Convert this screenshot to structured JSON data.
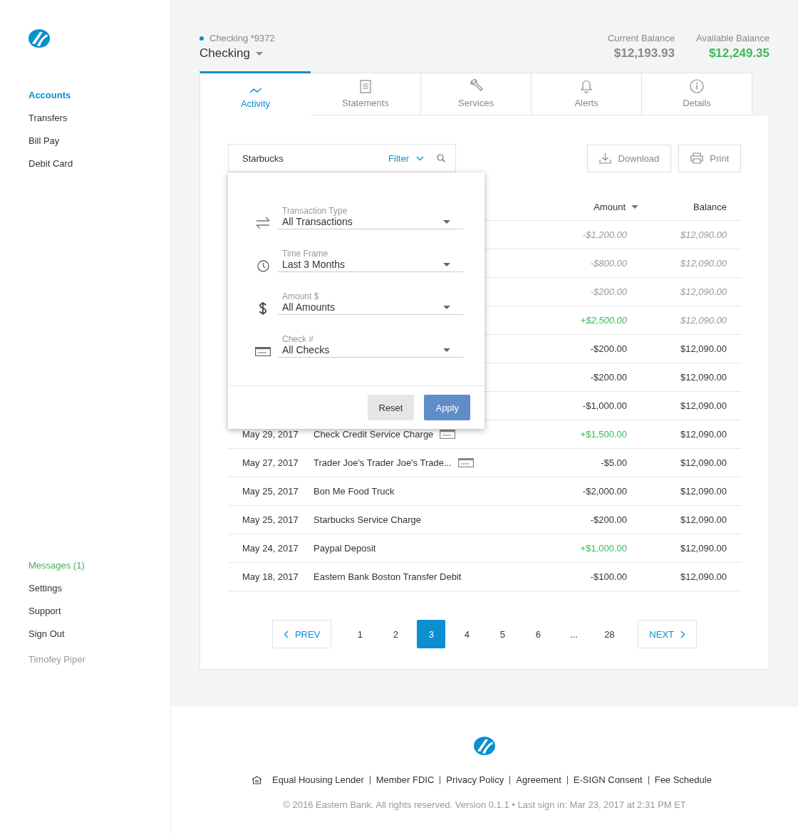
{
  "sidebar": {
    "nav": [
      {
        "label": "Accounts",
        "selected": true
      },
      {
        "label": "Transfers",
        "selected": false
      },
      {
        "label": "Bill Pay",
        "selected": false
      },
      {
        "label": "Debit Card",
        "selected": false
      }
    ],
    "bottom": [
      {
        "label": "Messages (1)",
        "kind": "messages"
      },
      {
        "label": "Settings",
        "kind": "link"
      },
      {
        "label": "Support",
        "kind": "link"
      },
      {
        "label": "Sign Out",
        "kind": "link"
      }
    ],
    "user": "Timofey Piper"
  },
  "account": {
    "subtitle": "Checking *9372",
    "name": "Checking",
    "balances": [
      {
        "label": "Current Balance",
        "value": "$12,193.93",
        "kind": "current"
      },
      {
        "label": "Available Balance",
        "value": "$12,249.35",
        "kind": "available"
      }
    ]
  },
  "tabs": [
    {
      "label": "Activity",
      "kind": "activity",
      "selected": true
    },
    {
      "label": "Statements",
      "kind": "statements",
      "selected": false
    },
    {
      "label": "Services",
      "kind": "services",
      "selected": false
    },
    {
      "label": "Alerts",
      "kind": "alerts",
      "selected": false
    },
    {
      "label": "Details",
      "kind": "details",
      "selected": false
    }
  ],
  "search": {
    "value": "Starbucks",
    "filter_label": "Filter"
  },
  "actions": [
    {
      "label": "Download",
      "kind": "download"
    },
    {
      "label": "Print",
      "kind": "print"
    }
  ],
  "table": {
    "columns": [
      {
        "label": "Amount",
        "sorted": true
      },
      {
        "label": "Balance",
        "sorted": false
      }
    ],
    "rows": [
      {
        "amount": "-$1,200.00",
        "balance": "$12,090.00",
        "pending": true,
        "credit": false
      },
      {
        "amount": "-$800.00",
        "balance": "$12,090.00",
        "pending": true,
        "credit": false
      },
      {
        "amount": "-$200.00",
        "balance": "$12,090.00",
        "pending": true,
        "credit": false
      },
      {
        "amount": "+$2,500.00",
        "balance": "$12,090.00",
        "pending": true,
        "credit": true
      },
      {
        "amount": "-$200.00",
        "balance": "$12,090.00",
        "pending": false,
        "credit": false
      },
      {
        "amount": "-$200.00",
        "balance": "$12,090.00",
        "pending": false,
        "credit": false
      },
      {
        "amount": "-$1,000.00",
        "balance": "$12,090.00",
        "pending": false,
        "credit": false
      },
      {
        "date": "May 29, 2017",
        "description": "Check Credit Service Charge",
        "amount": "+$1,500.00",
        "balance": "$12,090.00",
        "pending": false,
        "credit": true,
        "check": true
      },
      {
        "date": "May 27, 2017",
        "description": "Trader Joe's Trader Joe's Trade...",
        "amount": "-$5.00",
        "balance": "$12,090.00",
        "pending": false,
        "credit": false,
        "check": true
      },
      {
        "date": "May 25, 2017",
        "description": "Bon Me Food Truck",
        "amount": "-$2,000.00",
        "balance": "$12,090.00",
        "pending": false,
        "credit": false,
        "check": false
      },
      {
        "date": "May 25, 2017",
        "description": "Starbucks Service Charge",
        "amount": "-$200.00",
        "balance": "$12,090.00",
        "pending": false,
        "credit": false,
        "check": false
      },
      {
        "date": "May 24, 2017",
        "description": "Paypal Deposit",
        "amount": "+$1,000.00",
        "balance": "$12,090.00",
        "pending": false,
        "credit": true,
        "check": false
      },
      {
        "date": "May 18, 2017",
        "description": "Eastern Bank Boston Transfer Debit",
        "amount": "-$100.00",
        "balance": "$12,090.00",
        "pending": false,
        "credit": false,
        "check": false
      }
    ]
  },
  "filter_panel": {
    "fields": [
      {
        "kind": "type",
        "label": "Transaction Type",
        "value": "All Transactions"
      },
      {
        "kind": "time",
        "label": "Time Frame",
        "value": "Last 3 Months"
      },
      {
        "kind": "amount",
        "label": "Amount $",
        "value": "All Amounts"
      },
      {
        "kind": "check",
        "label": "Check #",
        "value": "All Checks"
      }
    ],
    "buttons": [
      {
        "label": "Reset",
        "kind": "secondary"
      },
      {
        "label": "Apply",
        "kind": "primary"
      }
    ]
  },
  "pagination": {
    "prev": "PREV",
    "next": "NEXT",
    "pages": [
      {
        "label": "1",
        "selected": false
      },
      {
        "label": "2",
        "selected": false
      },
      {
        "label": "3",
        "selected": true
      },
      {
        "label": "4",
        "selected": false
      },
      {
        "label": "5",
        "selected": false
      },
      {
        "label": "6",
        "selected": false
      },
      {
        "label": "...",
        "selected": false
      },
      {
        "label": "28",
        "selected": false
      }
    ]
  },
  "footer": {
    "links": [
      "Equal Housing Lender",
      "Member FDIC",
      "Privacy Policy",
      "Agreement",
      "E-SIGN Consent",
      "Fee Schedule"
    ],
    "copyright": "© 2016 Eastern Bank. All rights reserved. Version 0.1.1 • Last sign in: Mar 23, 2017 at 2:31 PM ET"
  }
}
